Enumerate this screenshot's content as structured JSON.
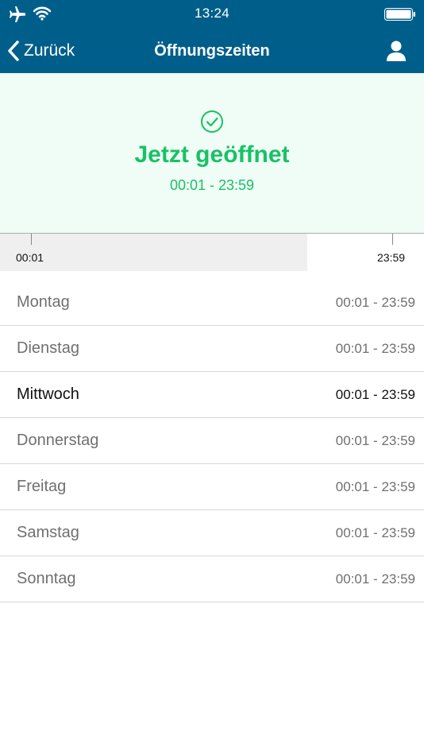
{
  "status_bar": {
    "time": "13:24",
    "icons": [
      "airplane-icon",
      "wifi-icon",
      "battery-icon"
    ]
  },
  "nav": {
    "back_label": "Zurück",
    "title": "Öffnungszeiten",
    "profile_icon": "person-icon"
  },
  "current": {
    "status": "Jetzt geöffnet",
    "hours": "00:01 - 23:59",
    "icon": "checkmark-circle-icon"
  },
  "timeline": {
    "start_label": "00:01",
    "end_label": "23:59",
    "progress_fraction": 0.725
  },
  "days": [
    {
      "name": "Montag",
      "hours": "00:01 - 23:59",
      "today": false
    },
    {
      "name": "Dienstag",
      "hours": "00:01 - 23:59",
      "today": false
    },
    {
      "name": "Mittwoch",
      "hours": "00:01 - 23:59",
      "today": true
    },
    {
      "name": "Donnerstag",
      "hours": "00:01 - 23:59",
      "today": false
    },
    {
      "name": "Freitag",
      "hours": "00:01 - 23:59",
      "today": false
    },
    {
      "name": "Samstag",
      "hours": "00:01 - 23:59",
      "today": false
    },
    {
      "name": "Sonntag",
      "hours": "00:01 - 23:59",
      "today": false
    }
  ],
  "colors": {
    "header": "#005f8a",
    "open_green": "#19c165",
    "panel_background": "#f0fcf6"
  }
}
